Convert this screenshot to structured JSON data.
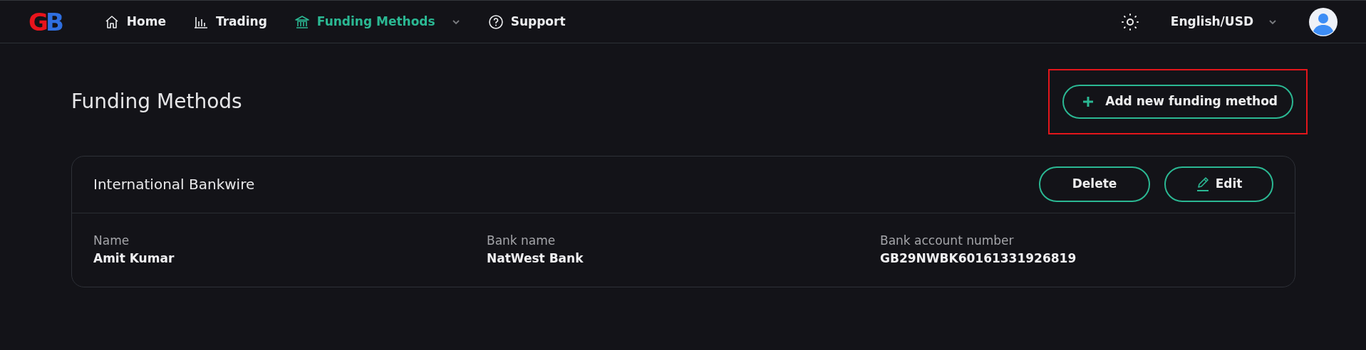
{
  "brand": {
    "letters": [
      "G",
      "B"
    ]
  },
  "nav": [
    {
      "kind": "home",
      "label": "Home",
      "selected": false,
      "dropdown": false
    },
    {
      "kind": "trading",
      "label": "Trading",
      "selected": false,
      "dropdown": false
    },
    {
      "kind": "funding",
      "label": "Funding Methods",
      "selected": true,
      "dropdown": true
    },
    {
      "kind": "support",
      "label": "Support",
      "selected": false,
      "dropdown": false
    }
  ],
  "locale": {
    "label": "English/USD"
  },
  "page_title": "Funding Methods",
  "add_button": {
    "label": "Add new funding method",
    "highlighted": true
  },
  "methods": [
    {
      "title": "International Bankwire",
      "actions": [
        {
          "kind": "delete",
          "label": "Delete"
        },
        {
          "kind": "edit",
          "label": "Edit"
        }
      ],
      "fields": [
        {
          "label": "Name",
          "value": "Amit Kumar"
        },
        {
          "label": "Bank name",
          "value": "NatWest Bank"
        },
        {
          "label": "Bank account number",
          "value": "GB29NWBK60161331926819"
        }
      ]
    }
  ]
}
